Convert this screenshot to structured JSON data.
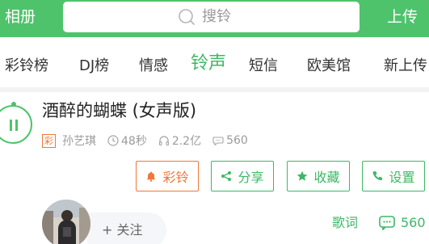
{
  "header": {
    "left_label": "相册",
    "right_label": "上传",
    "search_placeholder": "搜铃"
  },
  "tabs": [
    {
      "label": "彩铃榜"
    },
    {
      "label": "DJ榜"
    },
    {
      "label": "情感"
    },
    {
      "label": "铃声",
      "active": true
    },
    {
      "label": "短信"
    },
    {
      "label": "欧美馆"
    },
    {
      "label": "新上传"
    }
  ],
  "song": {
    "title": "酒醉的蝴蝶 (女声版)",
    "badge": "彩",
    "artist": "孙艺琪",
    "duration": "48秒",
    "plays": "2.2亿",
    "comments": "560"
  },
  "actions": {
    "ringback": "彩铃",
    "share": "分享",
    "favorite": "收藏",
    "set": "设置"
  },
  "footer": {
    "follow_label": "+ 关注",
    "lyrics_label": "歌词",
    "comment_count": "560"
  },
  "colors": {
    "brand_green": "#4fc36c",
    "accent_orange": "#f0763a"
  }
}
